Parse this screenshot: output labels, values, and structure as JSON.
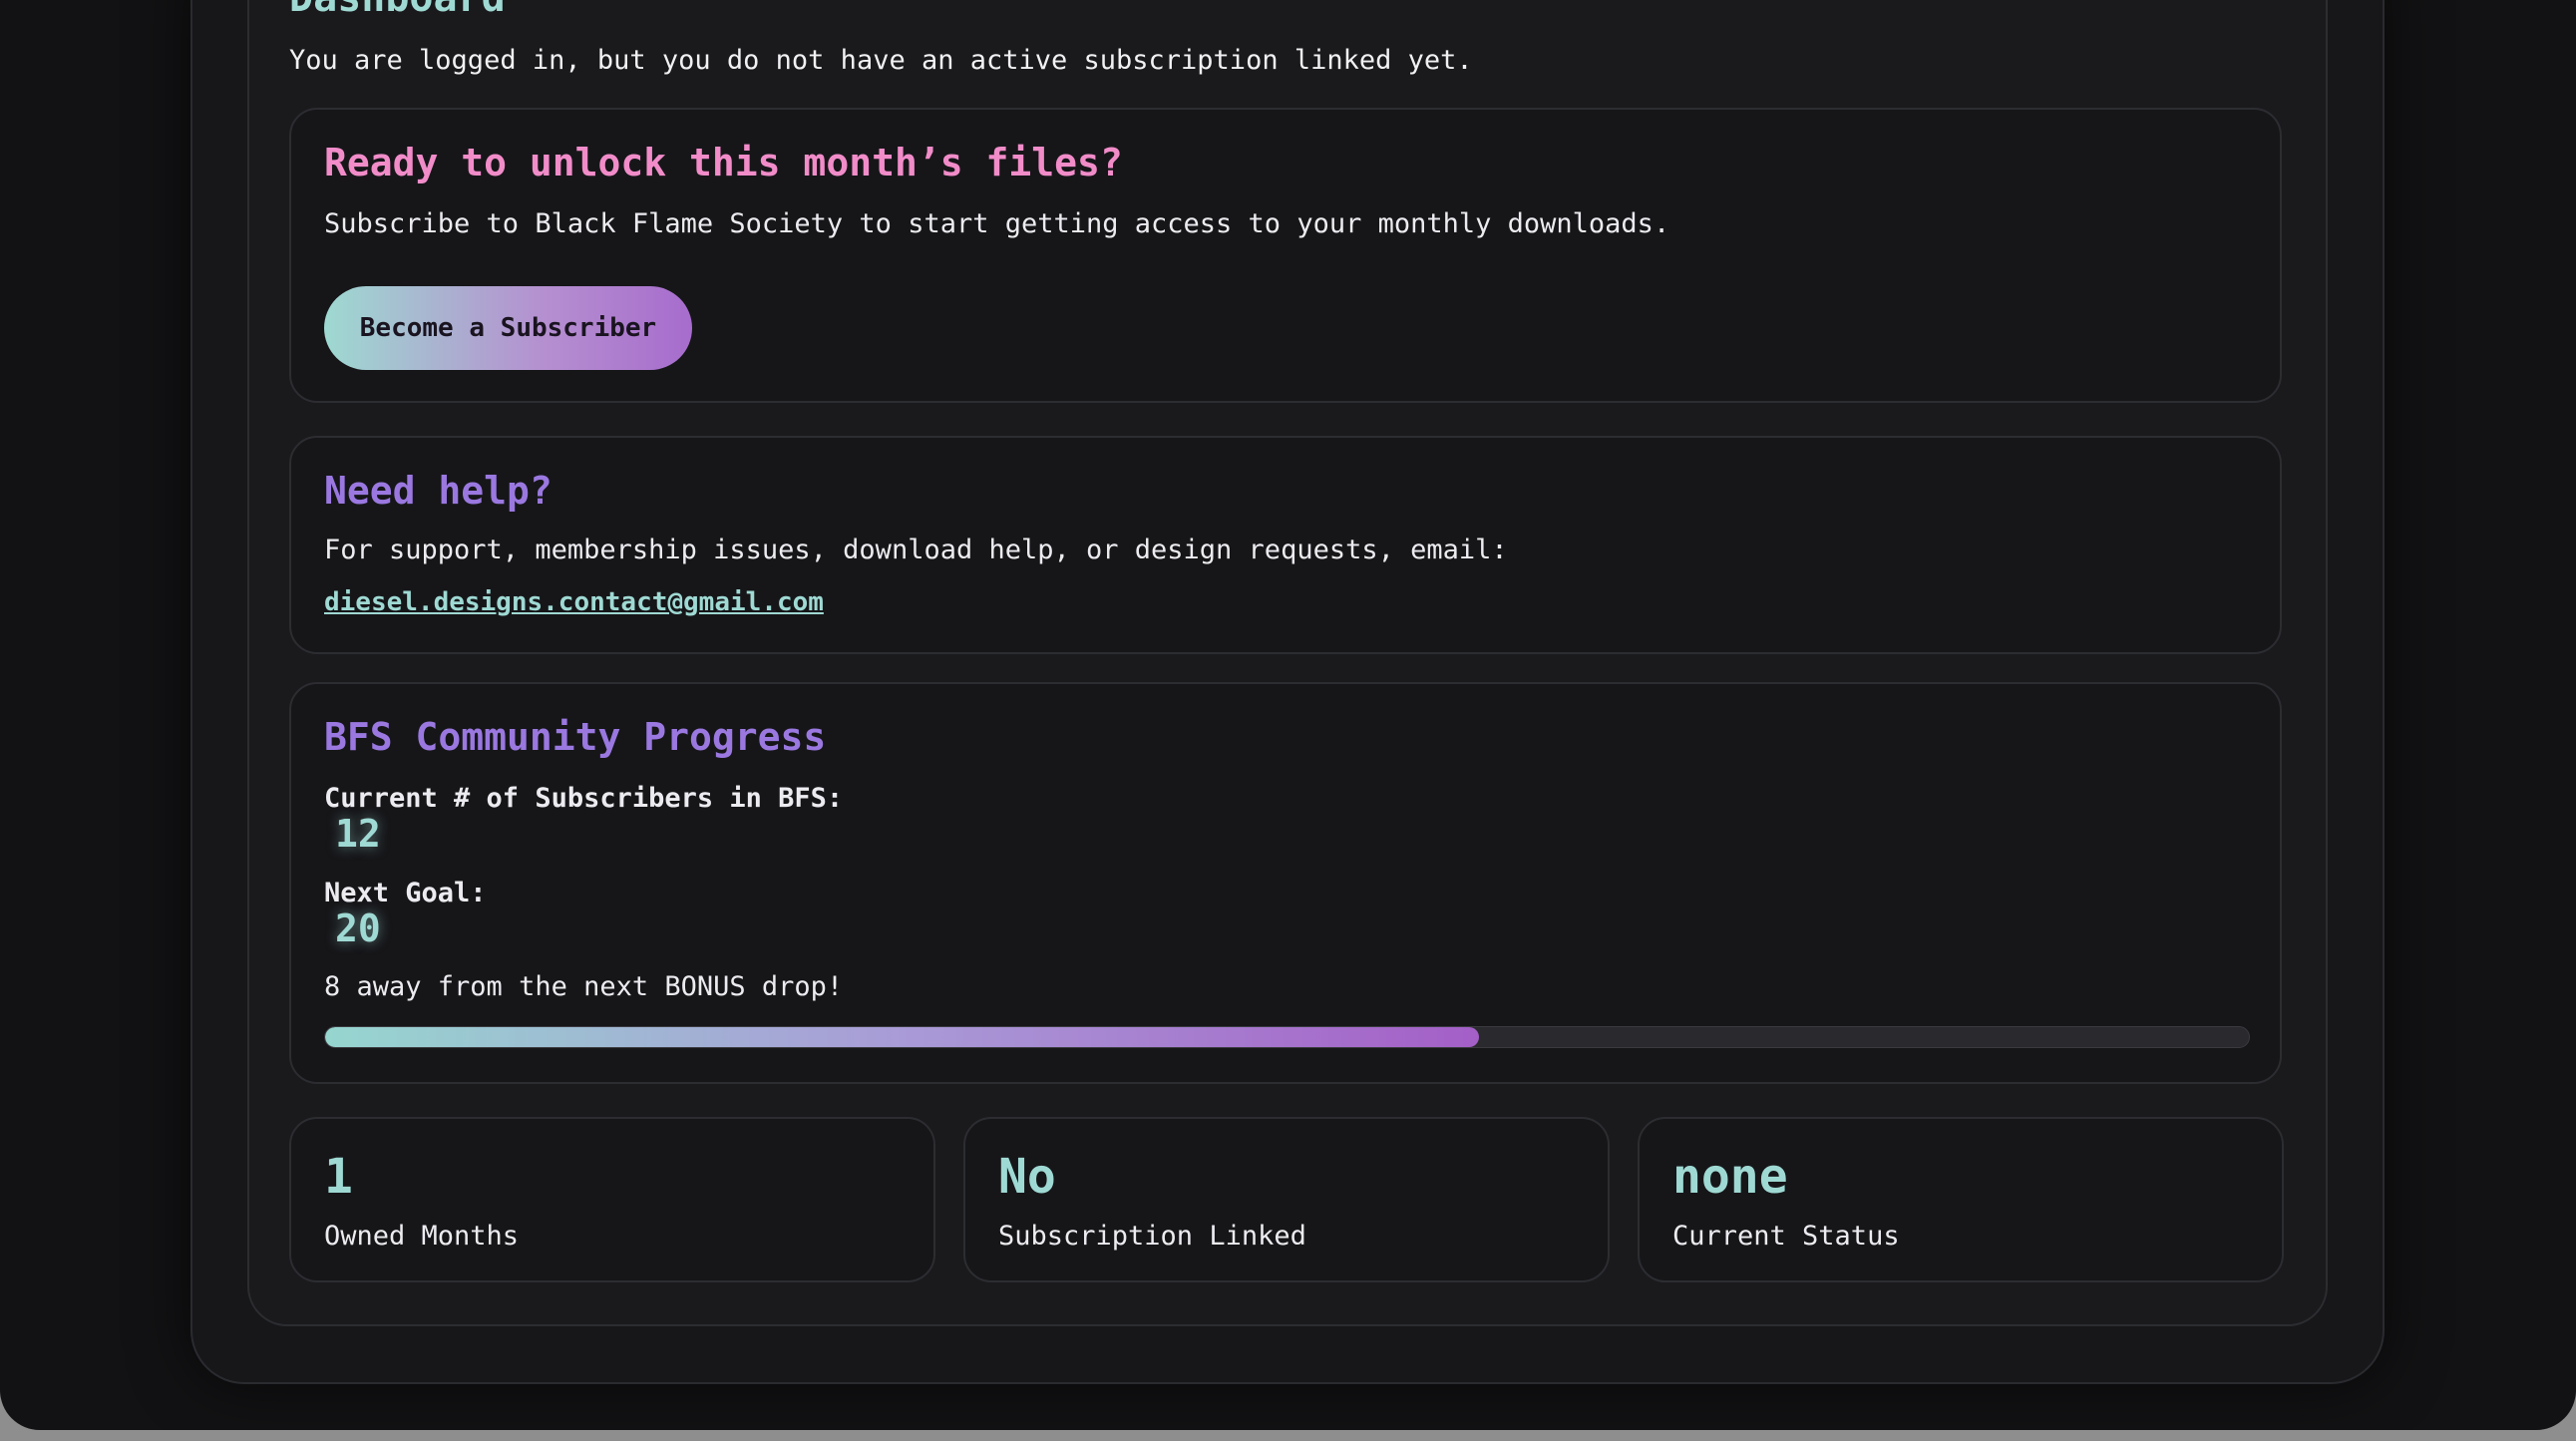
{
  "dashboard": {
    "title": "Dashboard",
    "intro": "You are logged in, but you do not have an active subscription linked yet."
  },
  "subscribe_card": {
    "heading": "Ready to unlock this month’s files?",
    "text": "Subscribe to Black Flame Society to start getting access to your monthly downloads.",
    "button_label": "Become a Subscriber"
  },
  "help_card": {
    "heading": "Need help?",
    "text": "For support, membership issues, download help, or design requests, email:",
    "email": "diesel.designs.contact@gmail.com"
  },
  "progress_card": {
    "heading": "BFS Community Progress",
    "subscribers_label": "Current # of Subscribers in BFS:",
    "subscribers_value": "12",
    "goal_label": "Next Goal:",
    "goal_value": "20",
    "message": "8 away from the next BONUS drop!",
    "progress_fraction": 0.6
  },
  "stats": [
    {
      "value": "1",
      "label": "Owned Months"
    },
    {
      "value": "No",
      "label": "Subscription Linked"
    },
    {
      "value": "none",
      "label": "Current Status"
    }
  ],
  "colors": {
    "accent_teal": "#9fd9d3",
    "accent_pink": "#f18cc9",
    "accent_violet": "#9a78e0",
    "background": "#121214"
  }
}
